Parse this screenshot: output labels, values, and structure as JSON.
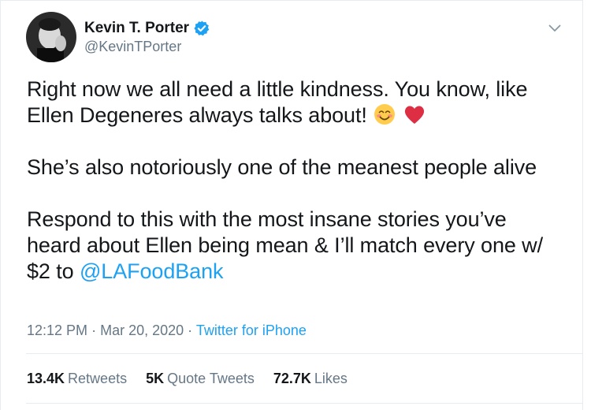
{
  "user": {
    "display_name": "Kevin T. Porter",
    "handle": "@KevinTPorter",
    "verified": true
  },
  "tweet": {
    "line1": "Right now we all need a little kindness. You know, like",
    "line2": "Ellen Degeneres always talks about!",
    "line3": "She’s also notoriously one of the meanest people alive",
    "line4": "Respond to this with the most insane stories you’ve",
    "line5": "heard about Ellen being mean & I’ll match every one w/",
    "line6_prefix": "$2 to",
    "mention": "@LAFoodBank",
    "emojis": [
      "smiling-face-with-smiling-eyes",
      "red-heart"
    ]
  },
  "meta": {
    "time": "12:12 PM",
    "separator": "·",
    "date": "Mar 20, 2020",
    "source": "Twitter for iPhone"
  },
  "stats": {
    "retweets_count": "13.4K",
    "retweets_label": "Retweets",
    "quotes_count": "5K",
    "quotes_label": "Quote Tweets",
    "likes_count": "72.7K",
    "likes_label": "Likes"
  },
  "colors": {
    "link": "#1da1f2",
    "secondary_text": "#657786",
    "primary_text": "#14171a",
    "divider": "#e6ecf0",
    "heart": "#e0245e"
  }
}
